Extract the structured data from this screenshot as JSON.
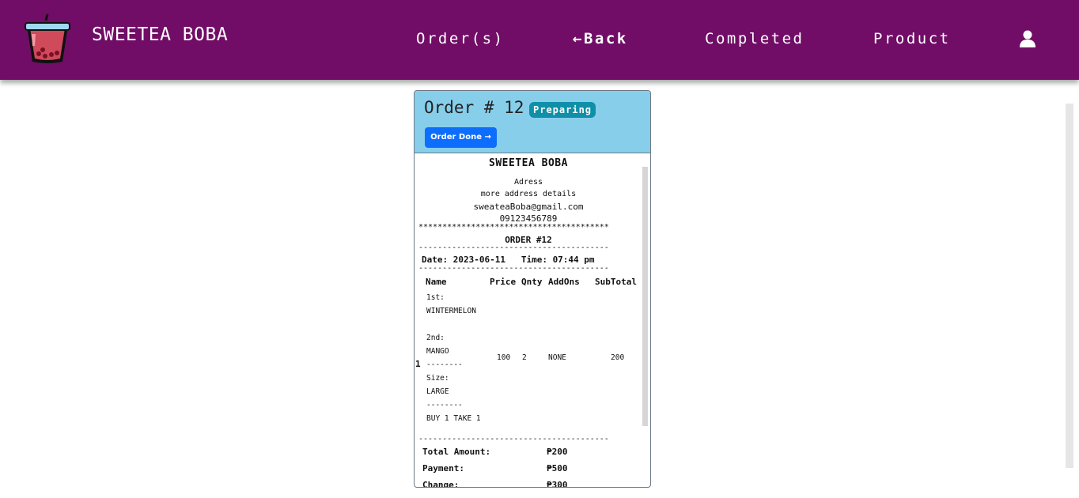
{
  "brand": {
    "name": "SWEETEA BOBA"
  },
  "nav": {
    "orders": "Order(s)",
    "back": "←Back",
    "completed": "Completed",
    "product": "Product"
  },
  "order": {
    "title": "Order # 12",
    "status": "Preparing",
    "done_button": "Order Done →"
  },
  "receipt": {
    "shop_name": "SWEETEA BOBA",
    "address": "Adress",
    "address_details": "more address details",
    "email": "sweateaBoba@gmail.com",
    "phone": "09123456789",
    "stars": "****************************************",
    "order_no": "ORDER #12",
    "dashes": "----------------------------------------",
    "date_time": "Date: 2023-06-11   Time: 07:44 pm",
    "headers": {
      "name": "Name",
      "price": "Price",
      "qnty": "Qnty",
      "addons": "AddOns",
      "subtotal": "SubTotal"
    },
    "item": {
      "index": "1",
      "lines": [
        "1st:",
        "WINTERMELON",
        "",
        "2nd:",
        "MANGO",
        "--------",
        "Size:",
        "LARGE",
        "--------",
        "BUY 1 TAKE 1"
      ],
      "price": "100",
      "qnty": "2",
      "addons": "NONE",
      "subtotal": "200"
    },
    "totals": {
      "total_label": "Total Amount:",
      "total_value": "₱200",
      "payment_label": "Payment:",
      "payment_value": "₱500",
      "change_label": "Change:",
      "change_value": "₱300"
    }
  }
}
